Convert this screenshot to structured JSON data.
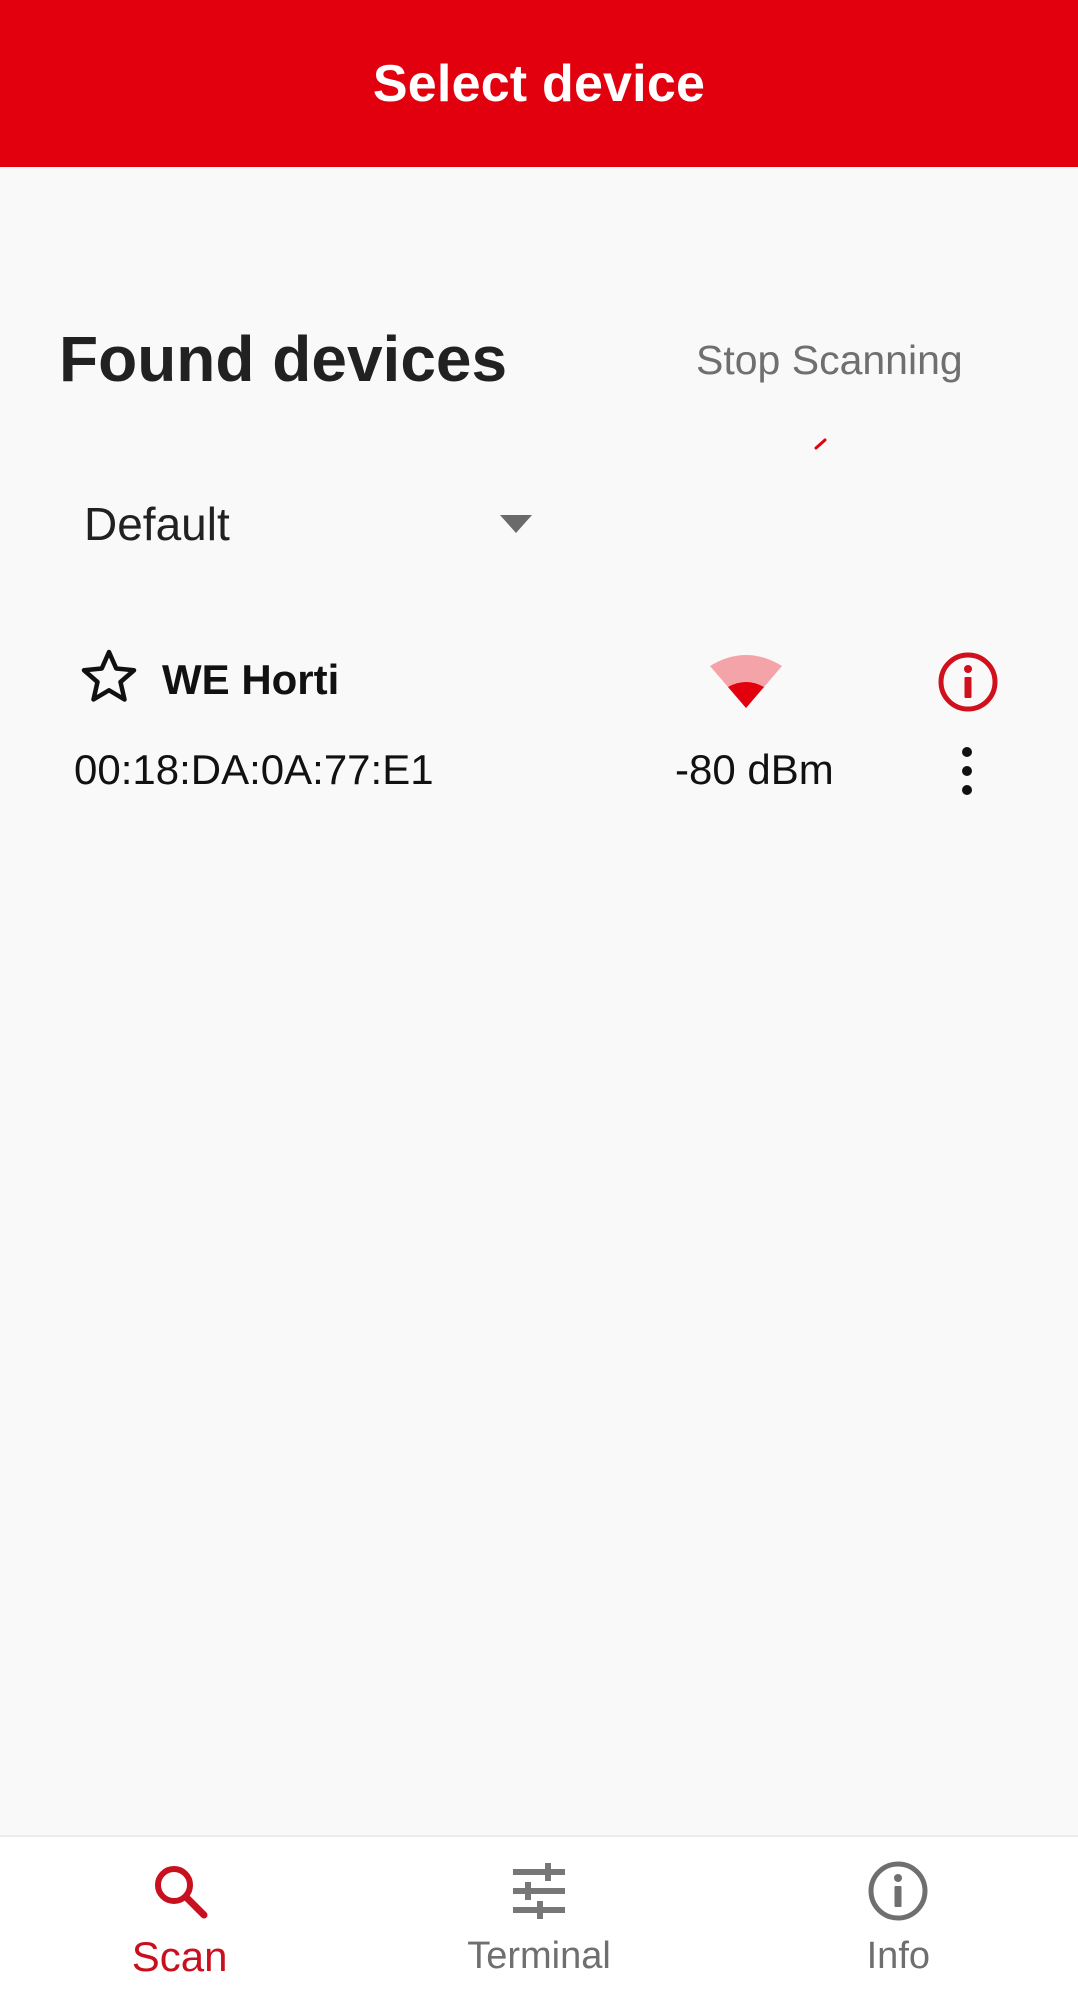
{
  "app_bar": {
    "title": "Select device"
  },
  "header": {
    "section_title": "Found devices",
    "stop_scan_label": "Stop Scanning"
  },
  "filter": {
    "selected": "Default"
  },
  "devices": [
    {
      "name": "WE Horti",
      "mac": "00:18:DA:0A:77:E1",
      "rssi": "-80 dBm",
      "favorite": false
    }
  ],
  "bottom_nav": {
    "items": [
      {
        "label": "Scan",
        "icon": "search-icon",
        "active": true
      },
      {
        "label": "Terminal",
        "icon": "sliders-icon",
        "active": false
      },
      {
        "label": "Info",
        "icon": "info-icon",
        "active": false
      }
    ]
  },
  "colors": {
    "brand": "#e2000f",
    "active_nav": "#c8101e",
    "inactive": "#6f6f6f",
    "signal_strong": "#e2000f",
    "signal_weak": "#f4a3a9"
  }
}
